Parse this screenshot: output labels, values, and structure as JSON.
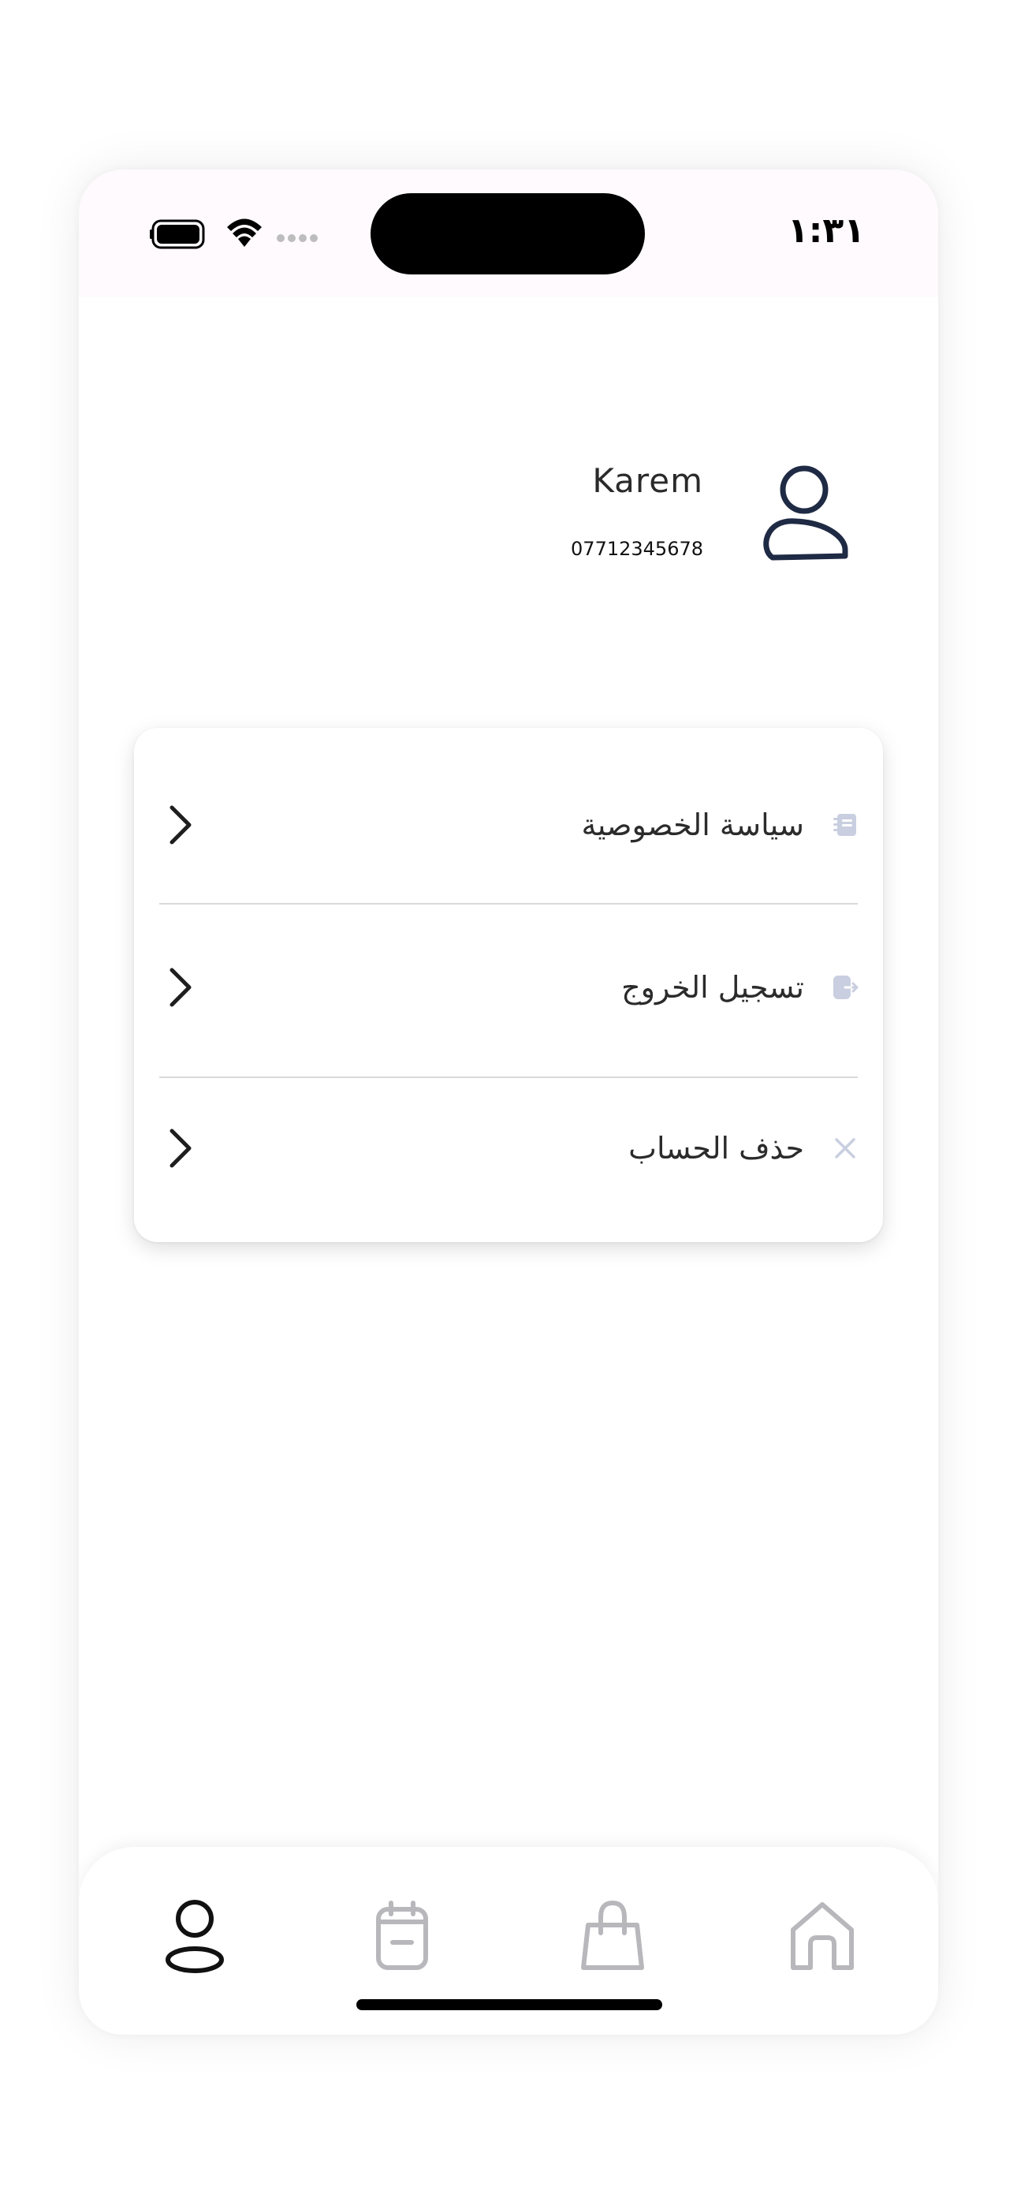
{
  "status_bar": {
    "time": "١:٣١",
    "icons": [
      "battery-icon",
      "wifi-icon",
      "signal-icon"
    ]
  },
  "profile": {
    "name": "Karem",
    "phone": "07712345678",
    "avatar_icon": "user-icon"
  },
  "menu": {
    "items": [
      {
        "label": "سياسة الخصوصية",
        "icon": "privacy-policy-icon"
      },
      {
        "label": "تسجيل الخروج",
        "icon": "logout-icon"
      },
      {
        "label": "حذف الحساب",
        "icon": "close-icon"
      }
    ]
  },
  "bottom_nav": {
    "items": [
      {
        "name": "profile",
        "icon": "user-icon",
        "active": true
      },
      {
        "name": "orders",
        "icon": "clipboard-icon",
        "active": false
      },
      {
        "name": "cart",
        "icon": "shopping-bag-icon",
        "active": false
      },
      {
        "name": "home",
        "icon": "home-icon",
        "active": false
      }
    ]
  },
  "colors": {
    "avatar": "#1f2a44",
    "menu_icon": "#c9cfe0",
    "nav_inactive": "#b8b8bc",
    "nav_active": "#111111",
    "status_bar_bg": "#fffafd"
  }
}
